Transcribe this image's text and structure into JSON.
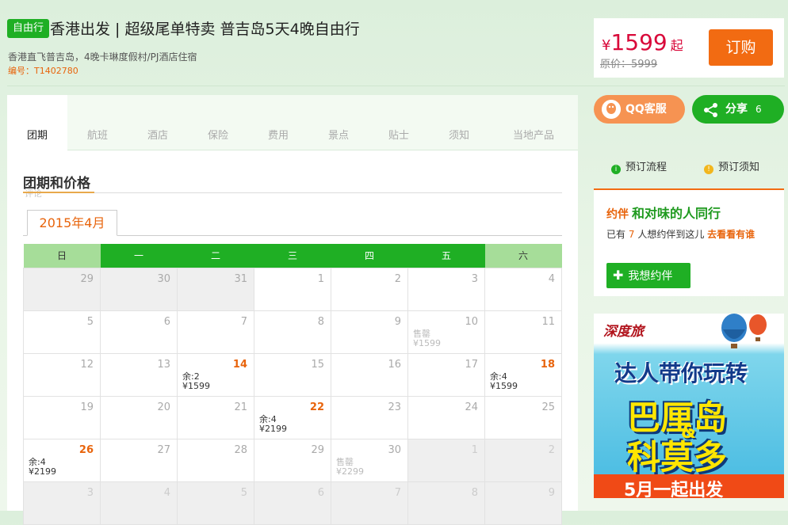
{
  "header": {
    "tag": "自由行",
    "title": "香港出发 | 超级尾单特卖 普吉岛5天4晚自由行",
    "subtitle": "香港直飞普吉岛，4晚卡琳度假村/PJ酒店住宿",
    "code_label": "编号：",
    "code": "T1402780"
  },
  "price_box": {
    "currency": "¥",
    "price": "1599",
    "suffix": "起",
    "original": "原价：5999",
    "book_label": "订购"
  },
  "tabs": [
    "团期",
    "航班",
    "酒店",
    "保险",
    "费用",
    "景点",
    "贴士",
    "须知",
    "当地产品"
  ],
  "section": {
    "title": "团期和价格",
    "ghost": "评论"
  },
  "calendar": {
    "month": "2015年4月",
    "weekdays": [
      "日",
      "一",
      "二",
      "三",
      "四",
      "五",
      "六"
    ],
    "weeks": [
      [
        {
          "day": "29",
          "style": "grey"
        },
        {
          "day": "30",
          "style": "grey"
        },
        {
          "day": "31",
          "style": "grey"
        },
        {
          "day": "1"
        },
        {
          "day": "2"
        },
        {
          "day": "3"
        },
        {
          "day": "4"
        }
      ],
      [
        {
          "day": "5"
        },
        {
          "day": "6"
        },
        {
          "day": "7"
        },
        {
          "day": "8"
        },
        {
          "day": "9"
        },
        {
          "day": "10",
          "stock": "售罄",
          "price": "¥1599",
          "sold": true
        },
        {
          "day": "11"
        }
      ],
      [
        {
          "day": "12"
        },
        {
          "day": "13"
        },
        {
          "day": "14",
          "stock": "余:2",
          "price": "¥1599",
          "avail": true
        },
        {
          "day": "15"
        },
        {
          "day": "16"
        },
        {
          "day": "17"
        },
        {
          "day": "18",
          "stock": "余:4",
          "price": "¥1599",
          "avail": true
        }
      ],
      [
        {
          "day": "19"
        },
        {
          "day": "20"
        },
        {
          "day": "21"
        },
        {
          "day": "22",
          "stock": "余:4",
          "price": "¥2199",
          "avail": true
        },
        {
          "day": "23"
        },
        {
          "day": "24"
        },
        {
          "day": "25"
        }
      ],
      [
        {
          "day": "26",
          "stock": "余:4",
          "price": "¥2199",
          "avail": true
        },
        {
          "day": "27"
        },
        {
          "day": "28"
        },
        {
          "day": "29"
        },
        {
          "day": "30",
          "stock": "售罄",
          "price": "¥2299",
          "sold": true
        },
        {
          "day": "1",
          "style": "grey",
          "muted": true
        },
        {
          "day": "2",
          "style": "grey",
          "muted": true
        }
      ],
      [
        {
          "day": "3",
          "style": "grey",
          "muted": true
        },
        {
          "day": "4",
          "style": "grey",
          "muted": true
        },
        {
          "day": "5",
          "style": "grey",
          "muted": true
        },
        {
          "day": "6",
          "style": "grey",
          "muted": true
        },
        {
          "day": "7",
          "style": "grey",
          "muted": true
        },
        {
          "day": "8",
          "style": "grey",
          "muted": true
        },
        {
          "day": "9",
          "style": "grey",
          "muted": true
        }
      ]
    ]
  },
  "sidebar": {
    "qq_label": "QQ客服",
    "share_label": "分享",
    "share_count": "6",
    "flow_label": "预订流程",
    "notice_label": "预订须知",
    "companion": {
      "brand": "约伴",
      "title": "和对味的人同行",
      "text_a": "已有",
      "count": "7",
      "text_b": "人想约伴到这儿",
      "link": "去看看有谁",
      "button": "我想约伴"
    }
  },
  "ad": {
    "logo": "深度旅",
    "line1": "达人带你玩转",
    "line2": "巴厘岛",
    "amp": "&",
    "line3": "科莫多",
    "bar": "5月一起出发"
  },
  "colors": {
    "brand_green": "#1faf24",
    "accent_orange": "#f26b12",
    "price_red": "#d9093a"
  }
}
